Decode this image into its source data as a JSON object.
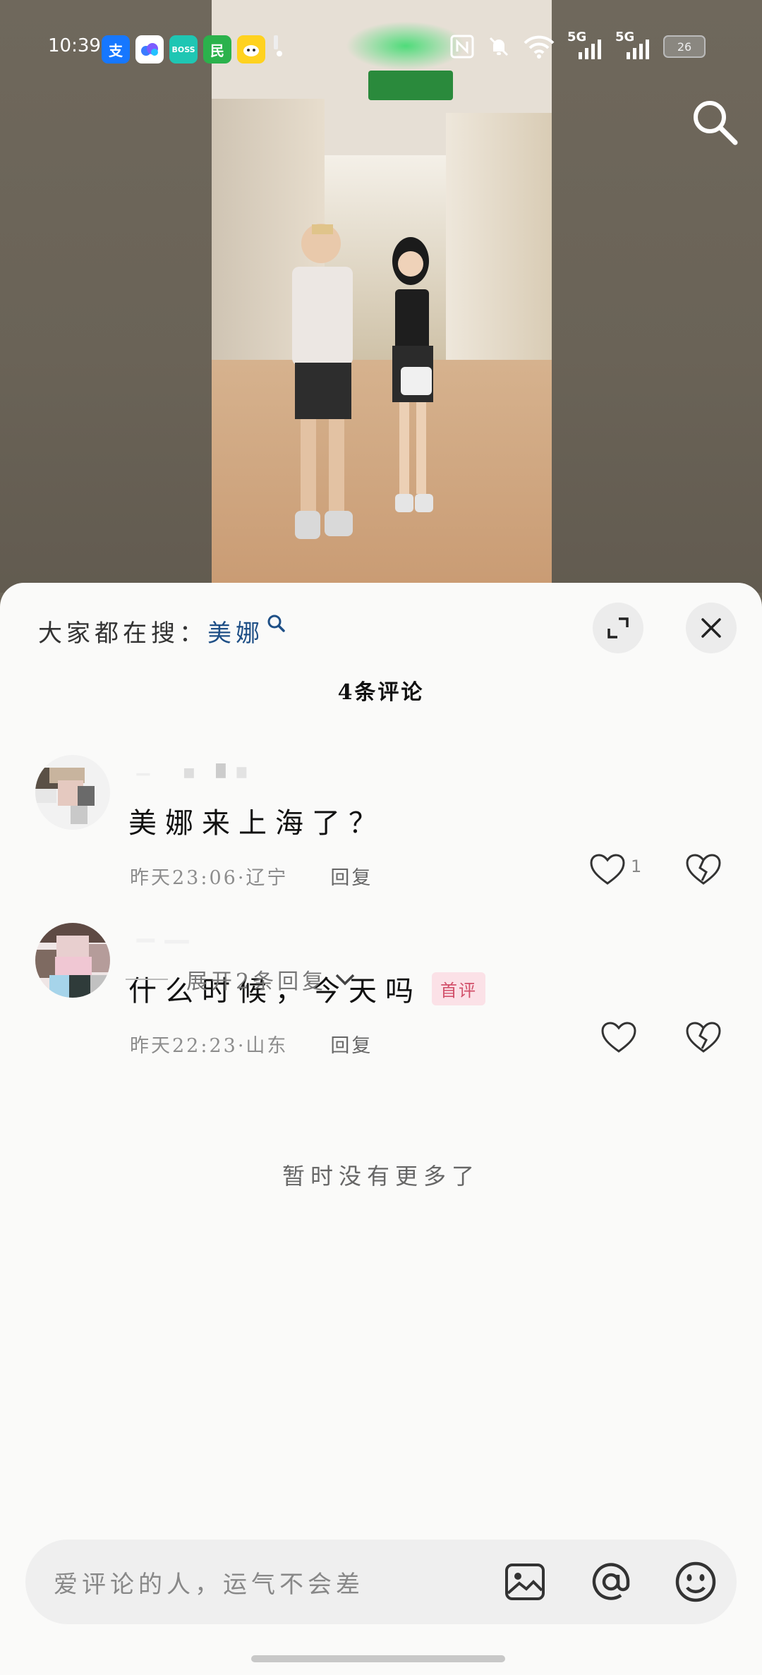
{
  "status_bar": {
    "time": "10:39",
    "app_icons": [
      {
        "icon": "alipay-icon",
        "glyph": "支",
        "color": "#1677ff"
      },
      {
        "icon": "cloud-app-icon",
        "glyph": "",
        "color": "#ffffff"
      },
      {
        "icon": "boss-zhipin-icon",
        "glyph": "BOSS",
        "color": "#1fc6b3"
      },
      {
        "icon": "min-app-icon",
        "glyph": "民",
        "color": "#2bb24c"
      },
      {
        "icon": "xianyu-icon",
        "glyph": "",
        "color": "#ffd21f"
      }
    ],
    "net1": "5G",
    "net2": "5G",
    "battery": "26"
  },
  "hot_search": {
    "label": "大家都在搜：",
    "keyword": "美娜"
  },
  "comments_count": "4条评论",
  "comments": [
    {
      "text": "美娜来上海了？",
      "time": "昨天23:06",
      "location": "辽宁",
      "reply_label": "回复",
      "like_count": "1",
      "badge": ""
    },
    {
      "text": "什么时候，今天吗",
      "time": "昨天22:23",
      "location": "山东",
      "reply_label": "回复",
      "like_count": "",
      "badge": "首评"
    }
  ],
  "expand_replies": "展开2条回复",
  "no_more": "暂时没有更多了",
  "input": {
    "placeholder": "爱评论的人，运气不会差"
  }
}
